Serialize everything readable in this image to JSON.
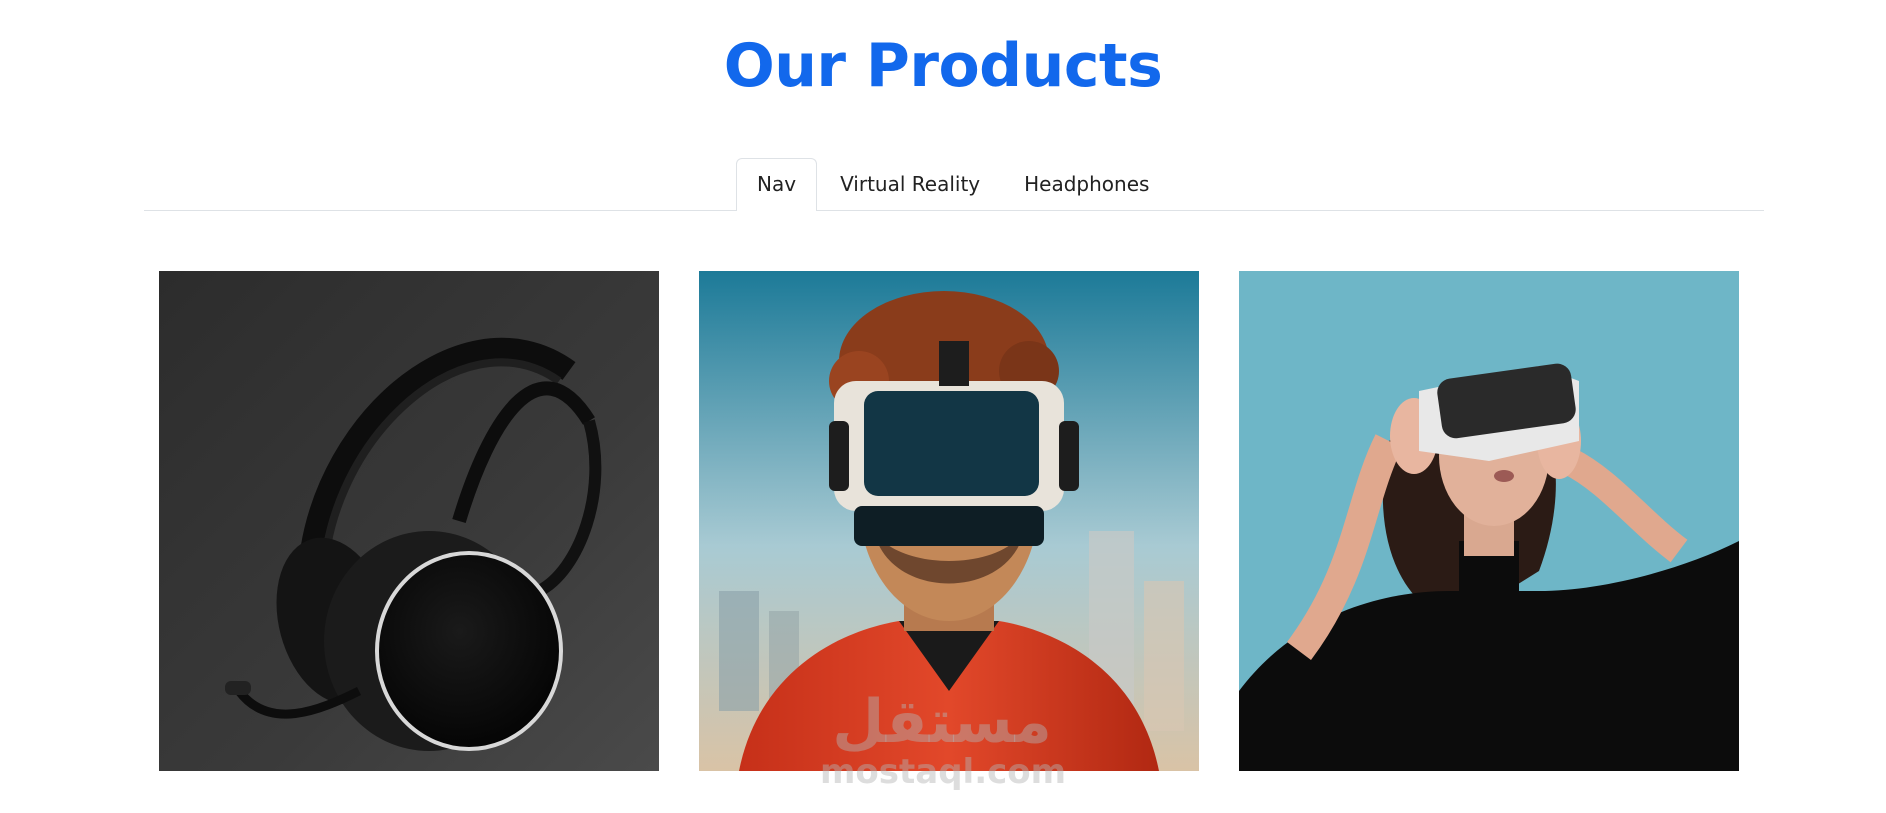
{
  "page": {
    "title": "Our Products"
  },
  "tabs": [
    {
      "label": "Nav",
      "active": true
    },
    {
      "label": "Virtual Reality",
      "active": false
    },
    {
      "label": "Headphones",
      "active": false
    }
  ],
  "products": [
    {
      "name": "headphones-photo",
      "alt": "Black over-ear gaming headphones with microphone"
    },
    {
      "name": "vr-man-photo",
      "alt": "Man wearing VR headset in red jacket"
    },
    {
      "name": "vr-woman-photo",
      "alt": "Woman wearing VR headset on teal background"
    }
  ],
  "watermark": {
    "arabic": "مستقل",
    "latin": "mostaql.com"
  },
  "colors": {
    "title": "#1268ec",
    "tab_border": "#dee2e6"
  }
}
